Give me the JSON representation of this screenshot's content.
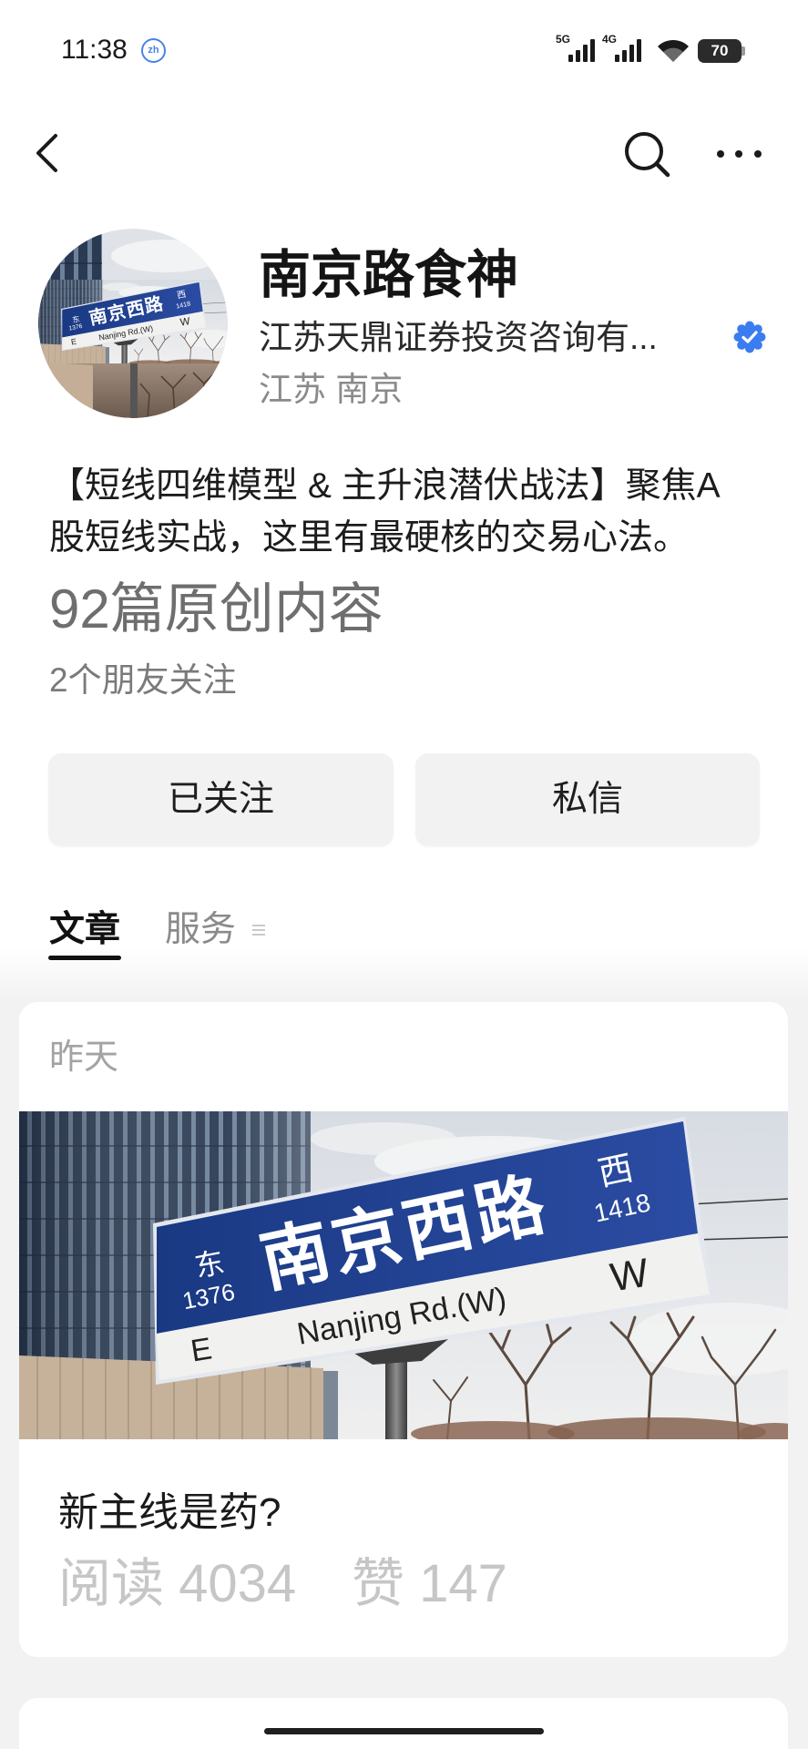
{
  "status_bar": {
    "time": "11:38",
    "ime_badge": "zh",
    "network_1": "5G",
    "network_2": "4G",
    "wifi_icon": "wifi-icon",
    "battery": "70"
  },
  "nav": {
    "back_icon": "chevron-left-icon",
    "search_icon": "search-icon",
    "more_icon": "more-horizontal-icon"
  },
  "profile": {
    "name": "南京路食神",
    "company": "江苏天鼎证券投资咨询有...",
    "verified_icon": "verified-badge-icon",
    "location": "江苏 南京",
    "bio_lines": [
      "【短线四维模型 & 主升浪潜伏战法】聚焦A",
      "股短线实战，这里有最硬核的交易心法。"
    ],
    "article_count": "92篇原创内容",
    "friends_following": "2个朋友关注"
  },
  "actions": {
    "follow_label": "已关注",
    "message_label": "私信"
  },
  "tabs": [
    {
      "label": "文章",
      "active": true
    },
    {
      "label": "服务",
      "active": false
    }
  ],
  "tab_menu_icon": "menu-icon",
  "feed": [
    {
      "date": "昨天",
      "cover_image": {
        "sign_main": "南京西路",
        "sign_east_char": "东",
        "sign_east_number": "1376",
        "sign_west_char": "西",
        "sign_west_number": "1418",
        "sign_road_en": "Nanjing Rd.(W)",
        "sign_dir_left": "E",
        "sign_dir_right": "W"
      },
      "title": "新主线是药?",
      "read_label": "阅读",
      "read_count": "4034",
      "like_label": "赞",
      "like_count": "147"
    }
  ],
  "colors": {
    "text_primary": "#1a1a1a",
    "text_secondary": "#8a8a8a",
    "button_bg": "#f2f2f2",
    "verified_blue": "#3b7cf0",
    "page_bg_lower": "#f2f2f2",
    "sign_blue": "#1f3f8f"
  }
}
